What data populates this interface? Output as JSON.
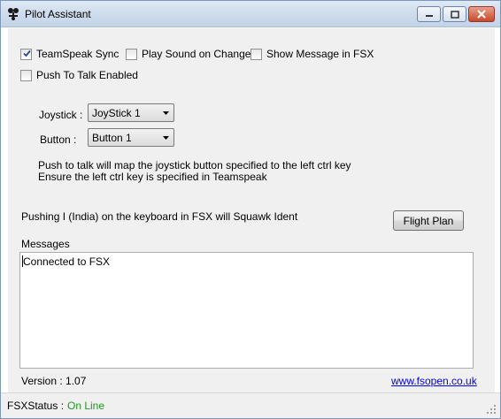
{
  "window": {
    "title": "Pilot Assistant",
    "icon": "pilot-logo-icon"
  },
  "options": {
    "teamspeak_sync": {
      "label": "TeamSpeak Sync",
      "checked": true
    },
    "play_sound": {
      "label": "Play Sound on Change",
      "checked": false
    },
    "show_message": {
      "label": "Show Message in FSX",
      "checked": false
    },
    "push_to_talk": {
      "label": "Push To Talk Enabled",
      "checked": false
    }
  },
  "joystick": {
    "label": "Joystick :",
    "selected": "JoyStick 1"
  },
  "button": {
    "label": "Button :",
    "selected": "Button 1"
  },
  "info": {
    "line1": "Push to talk will map the joystick button specified  to the left ctrl key",
    "line2": "Ensure the left ctrl key is specified in Teamspeak"
  },
  "squawk_note": "Pushing I (India) on the keyboard in FSX will Squawk Ident",
  "flight_plan_button": "Flight Plan",
  "messages": {
    "label": "Messages",
    "lines": [
      "Connected to FSX"
    ]
  },
  "version": "Version : 1.07",
  "website": "www.fsopen.co.uk",
  "status": {
    "label": "FSXStatus :",
    "value": "On Line",
    "value_color": "#1e9a1e"
  },
  "colors": {
    "link": "#0000ee",
    "window_background": "#f0f0f0"
  }
}
